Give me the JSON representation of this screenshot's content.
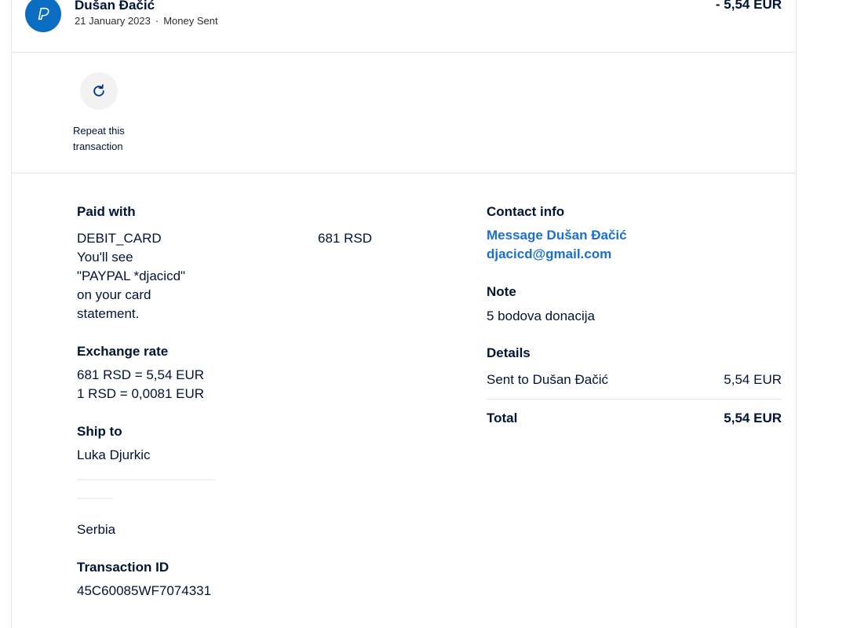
{
  "header": {
    "name": "Dušan Đačić",
    "date": "21 January 2023",
    "separator": "·",
    "type": "Money Sent",
    "amount": "- 5,54 EUR"
  },
  "actions": {
    "repeat_label": "Repeat this transaction"
  },
  "left": {
    "paid_with": {
      "title": "Paid with",
      "method": "DEBIT_CARD",
      "amount": "681 RSD",
      "statement_line1": "You'll see",
      "statement_line2": "\"PAYPAL *djacicd\"",
      "statement_line3": "on your card",
      "statement_line4": "statement."
    },
    "exchange": {
      "title": "Exchange rate",
      "rate1": "681 RSD = 5,54 EUR",
      "rate2": "1 RSD = 0,0081 EUR"
    },
    "ship_to": {
      "title": "Ship to",
      "name": "Luka Djurkic",
      "country": "Serbia"
    },
    "transaction": {
      "title": "Transaction ID",
      "id": "45C60085WF7074331"
    }
  },
  "right": {
    "contact": {
      "title": "Contact info",
      "message_link": "Message Dušan Đačić",
      "email": "djacicd@gmail.com"
    },
    "note": {
      "title": "Note",
      "text": "5 bodova donacija"
    },
    "details": {
      "title": "Details",
      "sent_label": "Sent to Dušan Đačić",
      "sent_amount": "5,54 EUR",
      "total_label": "Total",
      "total_amount": "5,54 EUR"
    }
  },
  "colors": {
    "accent": "#1a6fd1",
    "avatar_bg": "#0a6dc2",
    "text": "#001435"
  },
  "icons": {
    "avatar": "paypal-avatar-icon",
    "repeat": "refresh-icon"
  }
}
